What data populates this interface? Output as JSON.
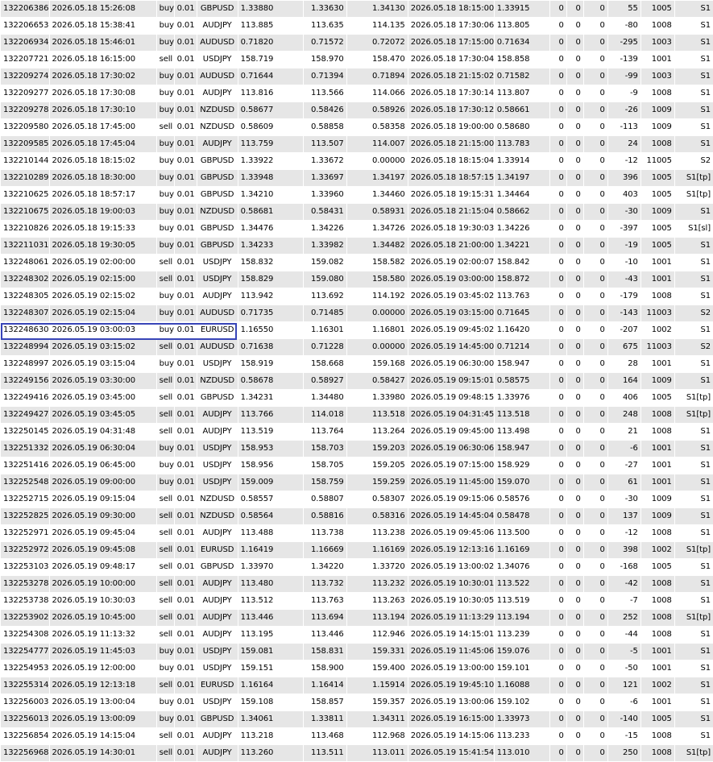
{
  "selected_row": "132248994",
  "rows": [
    [
      "132206386",
      "2026.05.18 15:26:08",
      "buy",
      "0.01",
      "GBPUSD",
      "1.33880",
      "1.33630",
      "1.34130",
      "2026.05.18 18:15:00",
      "1.33915",
      "0",
      "0",
      "0",
      "55",
      "1005",
      "S1"
    ],
    [
      "132206653",
      "2026.05.18 15:38:41",
      "buy",
      "0.01",
      "AUDJPY",
      "113.885",
      "113.635",
      "114.135",
      "2026.05.18 17:30:06",
      "113.805",
      "0",
      "0",
      "0",
      "-80",
      "1008",
      "S1"
    ],
    [
      "132206934",
      "2026.05.18 15:46:01",
      "buy",
      "0.01",
      "AUDUSD",
      "0.71820",
      "0.71572",
      "0.72072",
      "2026.05.18 17:15:00",
      "0.71634",
      "0",
      "0",
      "0",
      "-295",
      "1003",
      "S1"
    ],
    [
      "132207721",
      "2026.05.18 16:15:00",
      "sell",
      "0.01",
      "USDJPY",
      "158.719",
      "158.970",
      "158.470",
      "2026.05.18 17:30:04",
      "158.858",
      "0",
      "0",
      "0",
      "-139",
      "1001",
      "S1"
    ],
    [
      "132209274",
      "2026.05.18 17:30:02",
      "buy",
      "0.01",
      "AUDUSD",
      "0.71644",
      "0.71394",
      "0.71894",
      "2026.05.18 21:15:02",
      "0.71582",
      "0",
      "0",
      "0",
      "-99",
      "1003",
      "S1"
    ],
    [
      "132209277",
      "2026.05.18 17:30:08",
      "buy",
      "0.01",
      "AUDJPY",
      "113.816",
      "113.566",
      "114.066",
      "2026.05.18 17:30:14",
      "113.807",
      "0",
      "0",
      "0",
      "-9",
      "1008",
      "S1"
    ],
    [
      "132209278",
      "2026.05.18 17:30:10",
      "buy",
      "0.01",
      "NZDUSD",
      "0.58677",
      "0.58426",
      "0.58926",
      "2026.05.18 17:30:12",
      "0.58661",
      "0",
      "0",
      "0",
      "-26",
      "1009",
      "S1"
    ],
    [
      "132209580",
      "2026.05.18 17:45:00",
      "sell",
      "0.01",
      "NZDUSD",
      "0.58609",
      "0.58858",
      "0.58358",
      "2026.05.18 19:00:00",
      "0.58680",
      "0",
      "0",
      "0",
      "-113",
      "1009",
      "S1"
    ],
    [
      "132209585",
      "2026.05.18 17:45:04",
      "buy",
      "0.01",
      "AUDJPY",
      "113.759",
      "113.507",
      "114.007",
      "2026.05.18 21:15:00",
      "113.783",
      "0",
      "0",
      "0",
      "24",
      "1008",
      "S1"
    ],
    [
      "132210144",
      "2026.05.18 18:15:02",
      "buy",
      "0.01",
      "GBPUSD",
      "1.33922",
      "1.33672",
      "0.00000",
      "2026.05.18 18:15:04",
      "1.33914",
      "0",
      "0",
      "0",
      "-12",
      "11005",
      "S2"
    ],
    [
      "132210289",
      "2026.05.18 18:30:00",
      "buy",
      "0.01",
      "GBPUSD",
      "1.33948",
      "1.33697",
      "1.34197",
      "2026.05.18 18:57:15",
      "1.34197",
      "0",
      "0",
      "0",
      "396",
      "1005",
      "S1[tp]"
    ],
    [
      "132210625",
      "2026.05.18 18:57:17",
      "buy",
      "0.01",
      "GBPUSD",
      "1.34210",
      "1.33960",
      "1.34460",
      "2026.05.18 19:15:31",
      "1.34464",
      "0",
      "0",
      "0",
      "403",
      "1005",
      "S1[tp]"
    ],
    [
      "132210675",
      "2026.05.18 19:00:03",
      "buy",
      "0.01",
      "NZDUSD",
      "0.58681",
      "0.58431",
      "0.58931",
      "2026.05.18 21:15:04",
      "0.58662",
      "0",
      "0",
      "0",
      "-30",
      "1009",
      "S1"
    ],
    [
      "132210826",
      "2026.05.18 19:15:33",
      "buy",
      "0.01",
      "GBPUSD",
      "1.34476",
      "1.34226",
      "1.34726",
      "2026.05.18 19:30:03",
      "1.34226",
      "0",
      "0",
      "0",
      "-397",
      "1005",
      "S1[sl]"
    ],
    [
      "132211031",
      "2026.05.18 19:30:05",
      "buy",
      "0.01",
      "GBPUSD",
      "1.34233",
      "1.33982",
      "1.34482",
      "2026.05.18 21:00:00",
      "1.34221",
      "0",
      "0",
      "0",
      "-19",
      "1005",
      "S1"
    ],
    [
      "132248061",
      "2026.05.19 02:00:00",
      "sell",
      "0.01",
      "USDJPY",
      "158.832",
      "159.082",
      "158.582",
      "2026.05.19 02:00:07",
      "158.842",
      "0",
      "0",
      "0",
      "-10",
      "1001",
      "S1"
    ],
    [
      "132248302",
      "2026.05.19 02:15:00",
      "sell",
      "0.01",
      "USDJPY",
      "158.829",
      "159.080",
      "158.580",
      "2026.05.19 03:00:00",
      "158.872",
      "0",
      "0",
      "0",
      "-43",
      "1001",
      "S1"
    ],
    [
      "132248305",
      "2026.05.19 02:15:02",
      "buy",
      "0.01",
      "AUDJPY",
      "113.942",
      "113.692",
      "114.192",
      "2026.05.19 03:45:02",
      "113.763",
      "0",
      "0",
      "0",
      "-179",
      "1008",
      "S1"
    ],
    [
      "132248307",
      "2026.05.19 02:15:04",
      "buy",
      "0.01",
      "AUDUSD",
      "0.71735",
      "0.71485",
      "0.00000",
      "2026.05.19 03:15:00",
      "0.71645",
      "0",
      "0",
      "0",
      "-143",
      "11003",
      "S2"
    ],
    [
      "132248630",
      "2026.05.19 03:00:03",
      "buy",
      "0.01",
      "EURUSD",
      "1.16550",
      "1.16301",
      "1.16801",
      "2026.05.19 09:45:02",
      "1.16420",
      "0",
      "0",
      "0",
      "-207",
      "1002",
      "S1"
    ],
    [
      "132248994",
      "2026.05.19 03:15:02",
      "sell",
      "0.01",
      "AUDUSD",
      "0.71638",
      "0.71228",
      "0.00000",
      "2026.05.19 14:45:00",
      "0.71214",
      "0",
      "0",
      "0",
      "675",
      "11003",
      "S2"
    ],
    [
      "132248997",
      "2026.05.19 03:15:04",
      "buy",
      "0.01",
      "USDJPY",
      "158.919",
      "158.668",
      "159.168",
      "2026.05.19 06:30:00",
      "158.947",
      "0",
      "0",
      "0",
      "28",
      "1001",
      "S1"
    ],
    [
      "132249156",
      "2026.05.19 03:30:00",
      "sell",
      "0.01",
      "NZDUSD",
      "0.58678",
      "0.58927",
      "0.58427",
      "2026.05.19 09:15:01",
      "0.58575",
      "0",
      "0",
      "0",
      "164",
      "1009",
      "S1"
    ],
    [
      "132249416",
      "2026.05.19 03:45:00",
      "sell",
      "0.01",
      "GBPUSD",
      "1.34231",
      "1.34480",
      "1.33980",
      "2026.05.19 09:48:15",
      "1.33976",
      "0",
      "0",
      "0",
      "406",
      "1005",
      "S1[tp]"
    ],
    [
      "132249427",
      "2026.05.19 03:45:05",
      "sell",
      "0.01",
      "AUDJPY",
      "113.766",
      "114.018",
      "113.518",
      "2026.05.19 04:31:45",
      "113.518",
      "0",
      "0",
      "0",
      "248",
      "1008",
      "S1[tp]"
    ],
    [
      "132250145",
      "2026.05.19 04:31:48",
      "sell",
      "0.01",
      "AUDJPY",
      "113.519",
      "113.764",
      "113.264",
      "2026.05.19 09:45:00",
      "113.498",
      "0",
      "0",
      "0",
      "21",
      "1008",
      "S1"
    ],
    [
      "132251332",
      "2026.05.19 06:30:04",
      "buy",
      "0.01",
      "USDJPY",
      "158.953",
      "158.703",
      "159.203",
      "2026.05.19 06:30:06",
      "158.947",
      "0",
      "0",
      "0",
      "-6",
      "1001",
      "S1"
    ],
    [
      "132251416",
      "2026.05.19 06:45:00",
      "buy",
      "0.01",
      "USDJPY",
      "158.956",
      "158.705",
      "159.205",
      "2026.05.19 07:15:00",
      "158.929",
      "0",
      "0",
      "0",
      "-27",
      "1001",
      "S1"
    ],
    [
      "132252548",
      "2026.05.19 09:00:00",
      "buy",
      "0.01",
      "USDJPY",
      "159.009",
      "158.759",
      "159.259",
      "2026.05.19 11:45:00",
      "159.070",
      "0",
      "0",
      "0",
      "61",
      "1001",
      "S1"
    ],
    [
      "132252715",
      "2026.05.19 09:15:04",
      "sell",
      "0.01",
      "NZDUSD",
      "0.58557",
      "0.58807",
      "0.58307",
      "2026.05.19 09:15:06",
      "0.58576",
      "0",
      "0",
      "0",
      "-30",
      "1009",
      "S1"
    ],
    [
      "132252825",
      "2026.05.19 09:30:00",
      "sell",
      "0.01",
      "NZDUSD",
      "0.58564",
      "0.58816",
      "0.58316",
      "2026.05.19 14:45:04",
      "0.58478",
      "0",
      "0",
      "0",
      "137",
      "1009",
      "S1"
    ],
    [
      "132252971",
      "2026.05.19 09:45:04",
      "sell",
      "0.01",
      "AUDJPY",
      "113.488",
      "113.738",
      "113.238",
      "2026.05.19 09:45:06",
      "113.500",
      "0",
      "0",
      "0",
      "-12",
      "1008",
      "S1"
    ],
    [
      "132252972",
      "2026.05.19 09:45:08",
      "sell",
      "0.01",
      "EURUSD",
      "1.16419",
      "1.16669",
      "1.16169",
      "2026.05.19 12:13:16",
      "1.16169",
      "0",
      "0",
      "0",
      "398",
      "1002",
      "S1[tp]"
    ],
    [
      "132253103",
      "2026.05.19 09:48:17",
      "sell",
      "0.01",
      "GBPUSD",
      "1.33970",
      "1.34220",
      "1.33720",
      "2026.05.19 13:00:02",
      "1.34076",
      "0",
      "0",
      "0",
      "-168",
      "1005",
      "S1"
    ],
    [
      "132253278",
      "2026.05.19 10:00:00",
      "sell",
      "0.01",
      "AUDJPY",
      "113.480",
      "113.732",
      "113.232",
      "2026.05.19 10:30:01",
      "113.522",
      "0",
      "0",
      "0",
      "-42",
      "1008",
      "S1"
    ],
    [
      "132253738",
      "2026.05.19 10:30:03",
      "sell",
      "0.01",
      "AUDJPY",
      "113.512",
      "113.763",
      "113.263",
      "2026.05.19 10:30:05",
      "113.519",
      "0",
      "0",
      "0",
      "-7",
      "1008",
      "S1"
    ],
    [
      "132253902",
      "2026.05.19 10:45:00",
      "sell",
      "0.01",
      "AUDJPY",
      "113.446",
      "113.694",
      "113.194",
      "2026.05.19 11:13:29",
      "113.194",
      "0",
      "0",
      "0",
      "252",
      "1008",
      "S1[tp]"
    ],
    [
      "132254308",
      "2026.05.19 11:13:32",
      "sell",
      "0.01",
      "AUDJPY",
      "113.195",
      "113.446",
      "112.946",
      "2026.05.19 14:15:01",
      "113.239",
      "0",
      "0",
      "0",
      "-44",
      "1008",
      "S1"
    ],
    [
      "132254777",
      "2026.05.19 11:45:03",
      "buy",
      "0.01",
      "USDJPY",
      "159.081",
      "158.831",
      "159.331",
      "2026.05.19 11:45:06",
      "159.076",
      "0",
      "0",
      "0",
      "-5",
      "1001",
      "S1"
    ],
    [
      "132254953",
      "2026.05.19 12:00:00",
      "buy",
      "0.01",
      "USDJPY",
      "159.151",
      "158.900",
      "159.400",
      "2026.05.19 13:00:00",
      "159.101",
      "0",
      "0",
      "0",
      "-50",
      "1001",
      "S1"
    ],
    [
      "132255314",
      "2026.05.19 12:13:18",
      "sell",
      "0.01",
      "EURUSD",
      "1.16164",
      "1.16414",
      "1.15914",
      "2026.05.19 19:45:10",
      "1.16088",
      "0",
      "0",
      "0",
      "121",
      "1002",
      "S1"
    ],
    [
      "132256003",
      "2026.05.19 13:00:04",
      "buy",
      "0.01",
      "USDJPY",
      "159.108",
      "158.857",
      "159.357",
      "2026.05.19 13:00:06",
      "159.102",
      "0",
      "0",
      "0",
      "-6",
      "1001",
      "S1"
    ],
    [
      "132256013",
      "2026.05.19 13:00:09",
      "buy",
      "0.01",
      "GBPUSD",
      "1.34061",
      "1.33811",
      "1.34311",
      "2026.05.19 16:15:00",
      "1.33973",
      "0",
      "0",
      "0",
      "-140",
      "1005",
      "S1"
    ],
    [
      "132256854",
      "2026.05.19 14:15:04",
      "sell",
      "0.01",
      "AUDJPY",
      "113.218",
      "113.468",
      "112.968",
      "2026.05.19 14:15:06",
      "113.233",
      "0",
      "0",
      "0",
      "-15",
      "1008",
      "S1"
    ],
    [
      "132256968",
      "2026.05.19 14:30:01",
      "sell",
      "0.01",
      "AUDJPY",
      "113.260",
      "113.511",
      "113.011",
      "2026.05.19 15:41:54",
      "113.010",
      "0",
      "0",
      "0",
      "250",
      "1008",
      "S1[tp]"
    ]
  ]
}
